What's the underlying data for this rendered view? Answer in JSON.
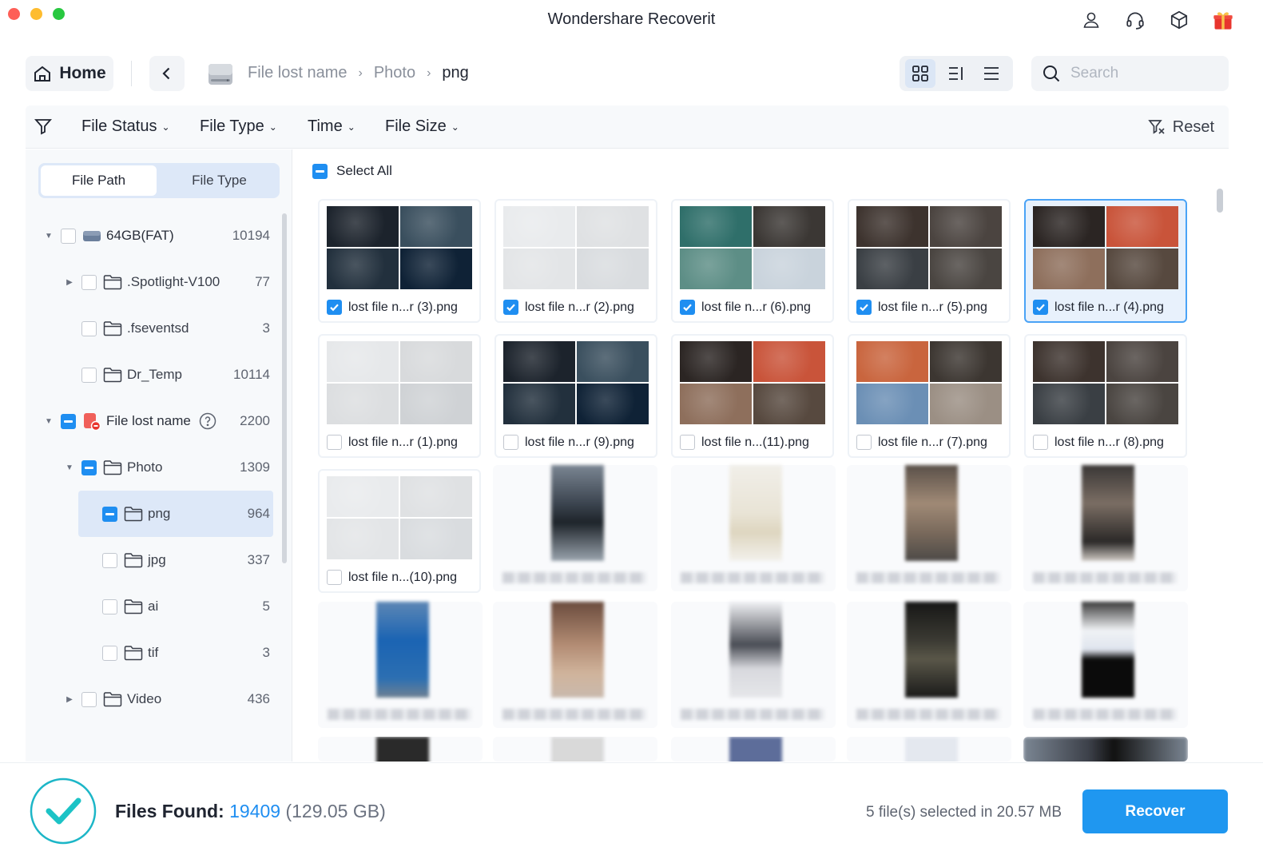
{
  "app": {
    "title": "Wondershare Recoverit"
  },
  "titlebar": {
    "icons": [
      "user-icon",
      "headset-icon",
      "cube-icon",
      "gift-icon"
    ]
  },
  "nav": {
    "home_label": "Home",
    "breadcrumb": [
      "File lost name",
      "Photo",
      "png"
    ]
  },
  "search": {
    "placeholder": "Search"
  },
  "filters": {
    "items": [
      "File Status",
      "File Type",
      "Time",
      "File Size"
    ],
    "reset": "Reset"
  },
  "sidebar": {
    "tabs": [
      "File Path",
      "File Type"
    ],
    "tree": [
      {
        "label": "64GB(FAT)",
        "count": "10194",
        "state": "unchecked",
        "icon": "drive-icon",
        "caret": "down"
      },
      {
        "label": ".Spotlight-V100",
        "count": "77",
        "state": "unchecked",
        "icon": "folder-icon",
        "caret": "right"
      },
      {
        "label": ".fseventsd",
        "count": "3",
        "state": "unchecked",
        "icon": "folder-icon",
        "caret": ""
      },
      {
        "label": "Dr_Temp",
        "count": "10114",
        "state": "unchecked",
        "icon": "folder-icon",
        "caret": ""
      },
      {
        "label": "File lost name",
        "count": "2200",
        "state": "partial",
        "icon": "lost-drive-icon",
        "caret": "down"
      },
      {
        "label": "Photo",
        "count": "1309",
        "state": "partial",
        "icon": "folder-icon",
        "caret": "down"
      },
      {
        "label": "png",
        "count": "964",
        "state": "partial",
        "icon": "folder-icon",
        "caret": ""
      },
      {
        "label": "jpg",
        "count": "337",
        "state": "unchecked",
        "icon": "folder-icon",
        "caret": ""
      },
      {
        "label": "ai",
        "count": "5",
        "state": "unchecked",
        "icon": "folder-icon",
        "caret": ""
      },
      {
        "label": "tif",
        "count": "3",
        "state": "unchecked",
        "icon": "folder-icon",
        "caret": ""
      },
      {
        "label": "Video",
        "count": "436",
        "state": "unchecked",
        "icon": "folder-icon",
        "caret": "right"
      }
    ]
  },
  "main": {
    "select_all": "Select All",
    "files": [
      {
        "name": "lost file n...r (3).png",
        "checked": true,
        "highlight": false,
        "colors": [
          "#1c232c",
          "#3a4f5e",
          "#22303d",
          "#0f2236"
        ]
      },
      {
        "name": "lost file n...r (2).png",
        "checked": true,
        "highlight": false,
        "colors": [
          "#e9ebed",
          "#dfe1e3",
          "#e3e5e7",
          "#d9dcdf"
        ]
      },
      {
        "name": "lost file n...r (6).png",
        "checked": true,
        "highlight": false,
        "colors": [
          "#2f6f6a",
          "#3b3734",
          "#5d8e86",
          "#c9d3dc"
        ]
      },
      {
        "name": "lost file n...r (5).png",
        "checked": true,
        "highlight": false,
        "colors": [
          "#3d332e",
          "#4b4440",
          "#3a3f44",
          "#4a4541"
        ]
      },
      {
        "name": "lost file n...r (4).png",
        "checked": true,
        "highlight": true,
        "colors": [
          "#2b2523",
          "#c9543a",
          "#8e6f5c",
          "#57493f"
        ]
      },
      {
        "name": "lost file n...r (1).png",
        "checked": false,
        "highlight": false,
        "colors": [
          "#e6e8ea",
          "#d8dadc",
          "#dcdee0",
          "#cfd2d5"
        ]
      },
      {
        "name": "lost file n...r (9).png",
        "checked": false,
        "highlight": false,
        "colors": [
          "#1c232c",
          "#3a4f5e",
          "#22303d",
          "#0f2236"
        ]
      },
      {
        "name": "lost file n...(11).png",
        "checked": false,
        "highlight": false,
        "colors": [
          "#2b2523",
          "#c9543a",
          "#8e6f5c",
          "#57493f"
        ]
      },
      {
        "name": "lost file n...r (7).png",
        "checked": false,
        "highlight": false,
        "colors": [
          "#c9653e",
          "#3c3631",
          "#6b8fb5",
          "#9b8f84"
        ]
      },
      {
        "name": "lost file n...r (8).png",
        "checked": false,
        "highlight": false,
        "colors": [
          "#3d332e",
          "#4b4440",
          "#3a3f44",
          "#4a4541"
        ]
      },
      {
        "name": "lost file n...(10).png",
        "checked": false,
        "highlight": false,
        "colors": [
          "#e9ebed",
          "#dfe1e3",
          "#e3e5e7",
          "#d9dcdf"
        ]
      }
    ]
  },
  "footer": {
    "found_label": "Files Found:",
    "found_count": "19409",
    "found_size": "(129.05 GB)",
    "selection": "5 file(s) selected in 20.57 MB",
    "recover_label": "Recover"
  },
  "colors": {
    "accent": "#1f8ef1",
    "selected_bg": "#dde8f8",
    "recover_button": "#1f97f0"
  }
}
